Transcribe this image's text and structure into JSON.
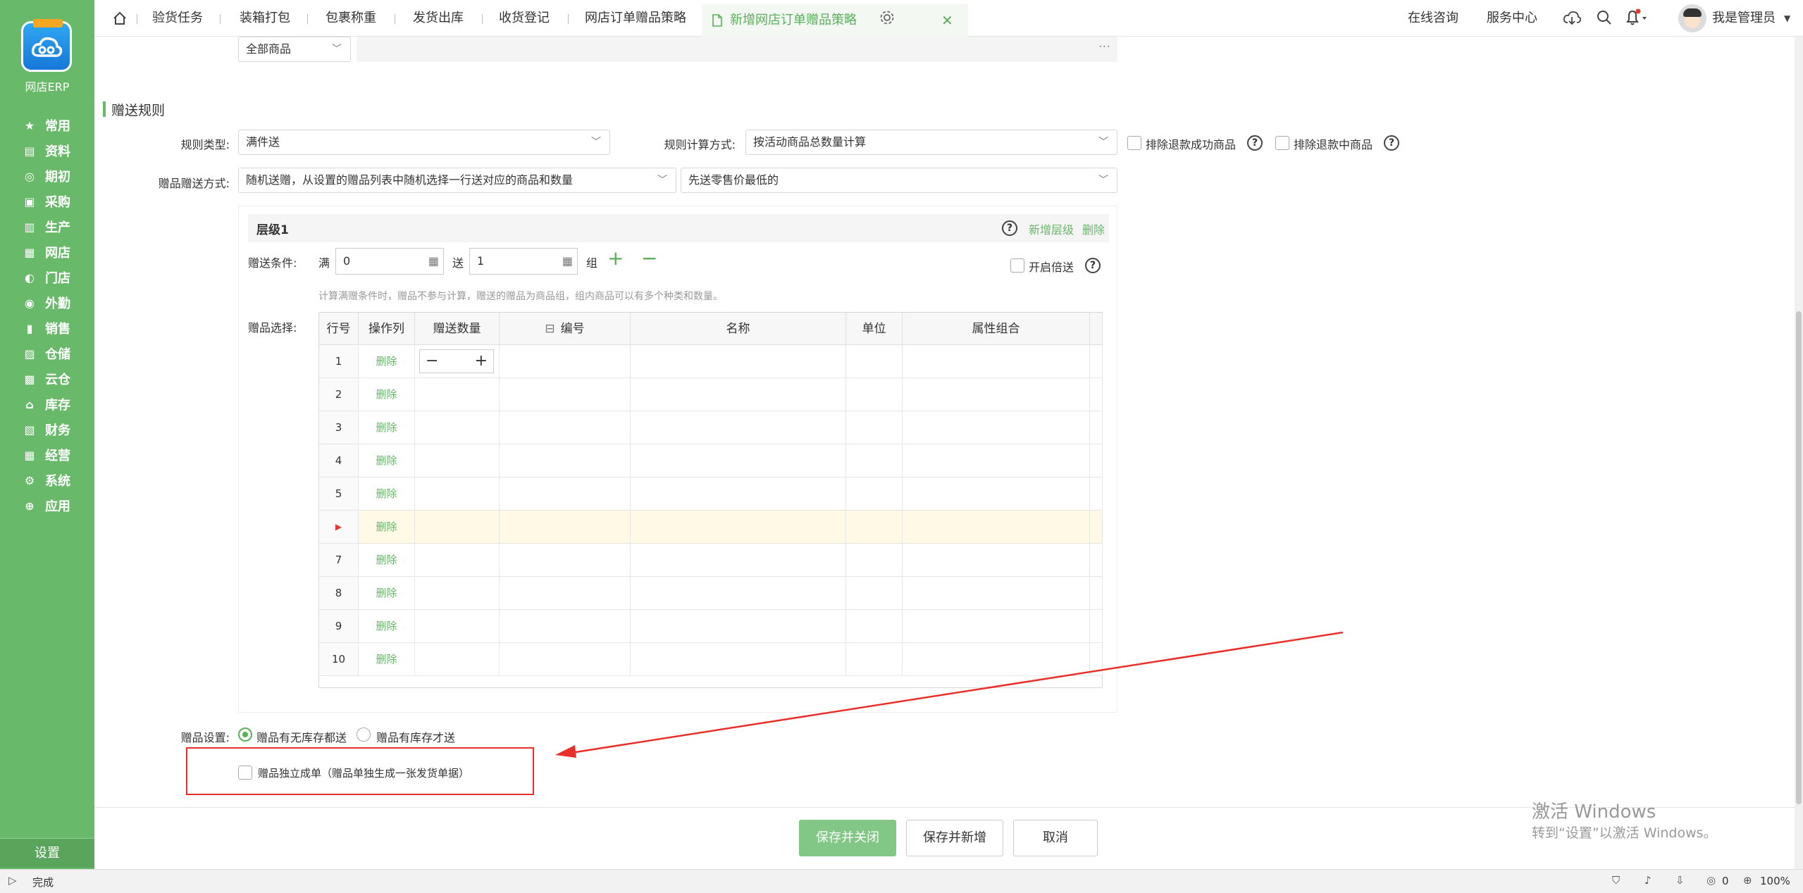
{
  "sidebar": {
    "app_name": "网店ERP",
    "items": [
      {
        "label": "常用",
        "icon": "star-icon"
      },
      {
        "label": "资料",
        "icon": "document-icon"
      },
      {
        "label": "期初",
        "icon": "target-icon"
      },
      {
        "label": "采购",
        "icon": "cart-icon"
      },
      {
        "label": "生产",
        "icon": "factory-icon"
      },
      {
        "label": "网店",
        "icon": "shop-icon"
      },
      {
        "label": "门店",
        "icon": "store-icon"
      },
      {
        "label": "外勤",
        "icon": "location-icon"
      },
      {
        "label": "销售",
        "icon": "chart-icon"
      },
      {
        "label": "仓储",
        "icon": "warehouse-icon"
      },
      {
        "label": "云仓",
        "icon": "cloud-warehouse-icon"
      },
      {
        "label": "库存",
        "icon": "inventory-icon"
      },
      {
        "label": "财务",
        "icon": "finance-icon"
      },
      {
        "label": "经营",
        "icon": "business-icon"
      },
      {
        "label": "系统",
        "icon": "gear-icon"
      },
      {
        "label": "应用",
        "icon": "plus-icon"
      }
    ],
    "settings_label": "设置"
  },
  "topbar": {
    "tabs": [
      "验货任务",
      "装箱打包",
      "包裹称重",
      "发货出库",
      "收货登记",
      "网店订单赠品策略"
    ],
    "active_tab": "新增网店订单赠品策略",
    "online_consult": "在线咨询",
    "service_center": "服务中心",
    "user_name": "我是管理员"
  },
  "form": {
    "product_scope": "全部商品",
    "section_title": "赠送规则",
    "rule_type_label": "规则类型:",
    "rule_type_value": "满件送",
    "calc_method_label": "规则计算方式:",
    "calc_method_value": "按活动商品总数量计算",
    "exclude_refund_success": "排除退款成功商品",
    "exclude_refunding": "排除退款中商品",
    "gift_method_label": "赠品赠送方式:",
    "gift_method_value": "随机送赠，从设置的赠品列表中随机选择一行送对应的商品和数量",
    "gift_priority_value": "先送零售价最低的",
    "level_title": "层级1",
    "add_level": "新增层级",
    "delete_level": "删除",
    "condition_label": "赠送条件:",
    "full_label": "满",
    "full_value": "0",
    "give_label": "送",
    "give_value": "1",
    "group_label": "组",
    "double_send": "开启倍送",
    "hint": "计算满赠条件时，赠品不参与计算，赠送的赠品为商品组，组内商品可以有多个种类和数量。",
    "gift_select_label": "赠品选择:",
    "table_headers": [
      "行号",
      "操作列",
      "赠送数量",
      "编号",
      "名称",
      "单位",
      "属性组合"
    ],
    "rows": [
      {
        "no": "1",
        "op": "删除"
      },
      {
        "no": "2",
        "op": "删除"
      },
      {
        "no": "3",
        "op": "删除"
      },
      {
        "no": "4",
        "op": "删除"
      },
      {
        "no": "5",
        "op": "删除"
      },
      {
        "no": "▶",
        "op": "删除"
      },
      {
        "no": "7",
        "op": "删除"
      },
      {
        "no": "8",
        "op": "删除"
      },
      {
        "no": "9",
        "op": "删除"
      },
      {
        "no": "10",
        "op": "删除"
      }
    ],
    "gift_setting_label": "赠品设置:",
    "radio_no_stock": "赠品有无库存都送",
    "radio_with_stock": "赠品有库存才送",
    "independent_order": "赠品独立成单（赠品单独生成一张发货单据）"
  },
  "buttons": {
    "save_close": "保存并关闭",
    "save_new": "保存并新增",
    "cancel": "取消"
  },
  "watermark": {
    "line1": "激活 Windows",
    "line2": "转到“设置”以激活 Windows。"
  },
  "status": {
    "text": "完成",
    "count": "0",
    "zoom": "100%"
  },
  "colors": {
    "accent": "#69b96b",
    "annotation": "#e8302a"
  }
}
